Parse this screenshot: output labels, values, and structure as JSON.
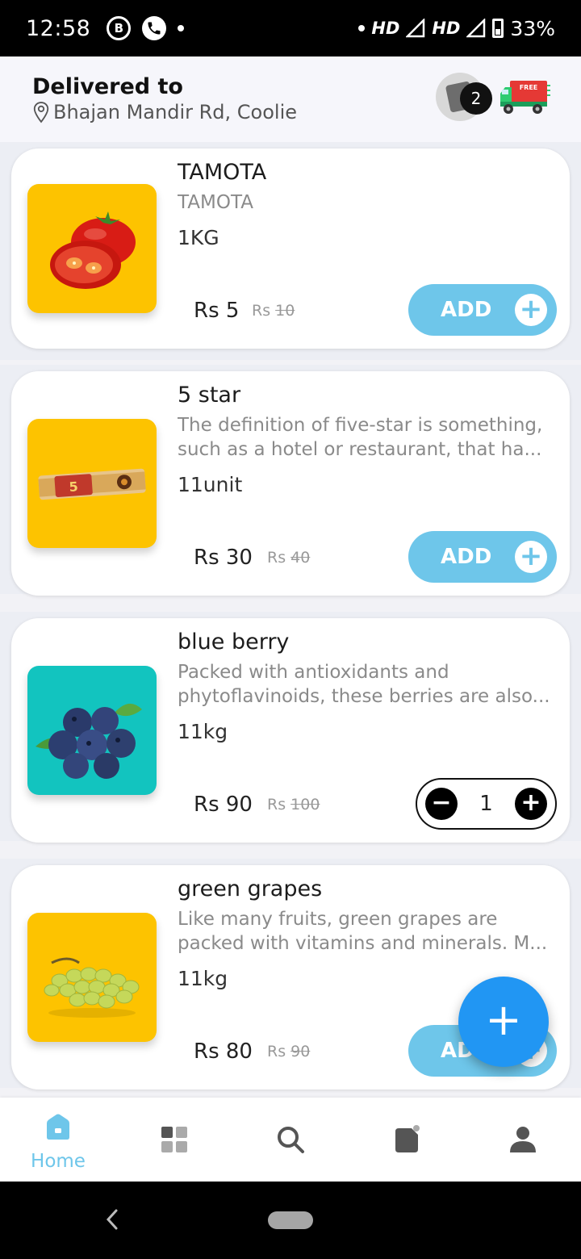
{
  "status_bar": {
    "time": "12:58",
    "left_icons": [
      "b-icon",
      "phone-icon",
      "dot"
    ],
    "network1": "HD",
    "network2": "HD",
    "battery": "33%"
  },
  "header": {
    "title": "Delivered to",
    "address": "Bhajan Mandir Rd, Coolie",
    "cart_count": "2",
    "truck_label": "FREE"
  },
  "products": [
    {
      "name": "TAMOTA",
      "description": "TAMOTA",
      "unit": "1KG",
      "price": "Rs 5",
      "mrp_prefix": "Rs",
      "mrp": "10",
      "action": "ADD",
      "image": "tomato",
      "bg": "#fdc300"
    },
    {
      "name": "5 star",
      "description": "The definition of five-star is something, such as a hotel or restaurant, that ha...",
      "unit": "11unit",
      "price": "Rs 30",
      "mrp_prefix": "Rs",
      "mrp": "40",
      "action": "ADD",
      "image": "chocolate-bar",
      "bg": "#fdc300"
    },
    {
      "name": "blue berry",
      "description": "Packed with antioxidants and phytoflavinoids, these berries are also...",
      "unit": "11kg",
      "price": "Rs 90",
      "mrp_prefix": "Rs",
      "mrp": "100",
      "quantity": "1",
      "image": "blueberries",
      "bg": "#12c4bf"
    },
    {
      "name": "green grapes",
      "description": "Like many fruits, green grapes are packed with vitamins and minerals. M...",
      "unit": "11kg",
      "price": "Rs 80",
      "mrp_prefix": "Rs",
      "mrp": "90",
      "action": "ADD",
      "image": "grapes",
      "bg": "#fdc300"
    }
  ],
  "bottom_nav": {
    "items": [
      {
        "label": "Home",
        "icon": "home-icon",
        "active": true
      },
      {
        "label": "",
        "icon": "categories-icon"
      },
      {
        "label": "",
        "icon": "search-icon"
      },
      {
        "label": "",
        "icon": "orders-icon"
      },
      {
        "label": "",
        "icon": "profile-icon"
      }
    ]
  },
  "colors": {
    "accent": "#6ec6ea",
    "fab": "#2196f3",
    "thumb_yellow": "#fdc300",
    "thumb_teal": "#12c4bf"
  }
}
